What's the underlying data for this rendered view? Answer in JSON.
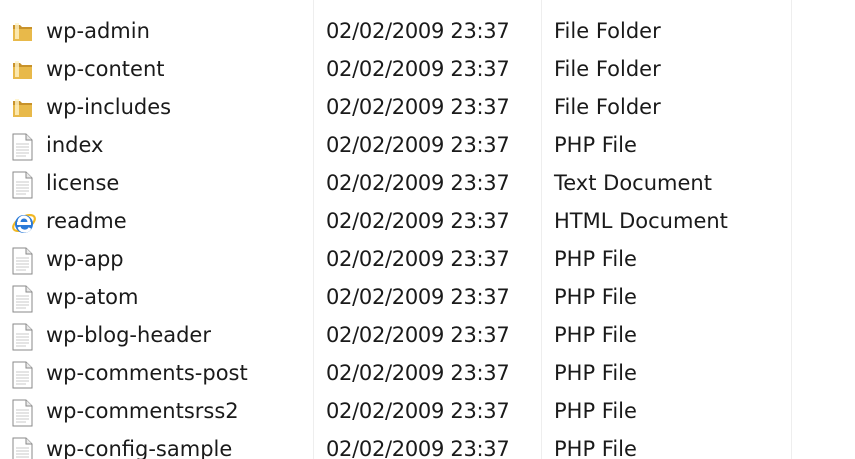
{
  "file_list": {
    "rows": [
      {
        "name": "wp-admin",
        "date_modified": "02/02/2009 23:37",
        "type": "File Folder",
        "icon": "folder-icon"
      },
      {
        "name": "wp-content",
        "date_modified": "02/02/2009 23:37",
        "type": "File Folder",
        "icon": "folder-icon"
      },
      {
        "name": "wp-includes",
        "date_modified": "02/02/2009 23:37",
        "type": "File Folder",
        "icon": "folder-icon"
      },
      {
        "name": "index",
        "date_modified": "02/02/2009 23:37",
        "type": "PHP File",
        "icon": "document-icon"
      },
      {
        "name": "license",
        "date_modified": "02/02/2009 23:37",
        "type": "Text Document",
        "icon": "document-icon"
      },
      {
        "name": "readme",
        "date_modified": "02/02/2009 23:37",
        "type": "HTML Document",
        "icon": "internet-explorer-icon"
      },
      {
        "name": "wp-app",
        "date_modified": "02/02/2009 23:37",
        "type": "PHP File",
        "icon": "document-icon"
      },
      {
        "name": "wp-atom",
        "date_modified": "02/02/2009 23:37",
        "type": "PHP File",
        "icon": "document-icon"
      },
      {
        "name": "wp-blog-header",
        "date_modified": "02/02/2009 23:37",
        "type": "PHP File",
        "icon": "document-icon"
      },
      {
        "name": "wp-comments-post",
        "date_modified": "02/02/2009 23:37",
        "type": "PHP File",
        "icon": "document-icon"
      },
      {
        "name": "wp-commentsrss2",
        "date_modified": "02/02/2009 23:37",
        "type": "PHP File",
        "icon": "document-icon"
      },
      {
        "name": "wp-config-sample",
        "date_modified": "02/02/2009 23:37",
        "type": "PHP File",
        "icon": "document-icon"
      }
    ]
  },
  "colors": {
    "folder": "#e8b94a",
    "folder_dark": "#c8922a",
    "ie_blue": "#2a7ad8",
    "ie_ring": "#f2b824",
    "text": "#1a1a1a"
  }
}
